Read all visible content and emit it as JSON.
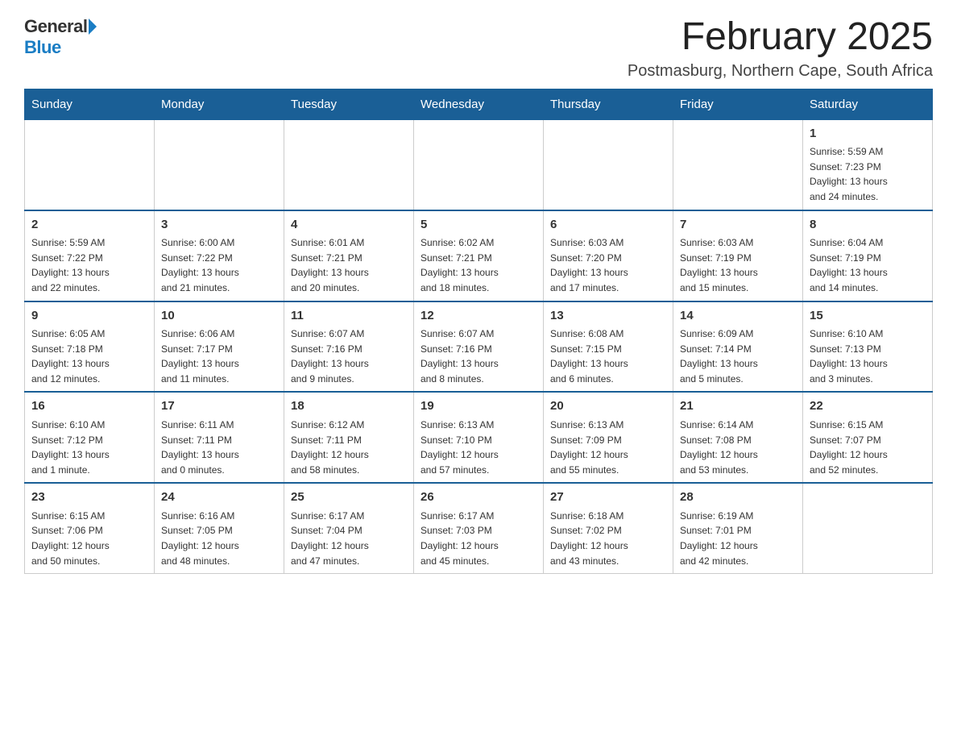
{
  "logo": {
    "general": "General",
    "blue": "Blue"
  },
  "header": {
    "month": "February 2025",
    "location": "Postmasburg, Northern Cape, South Africa"
  },
  "weekdays": [
    "Sunday",
    "Monday",
    "Tuesday",
    "Wednesday",
    "Thursday",
    "Friday",
    "Saturday"
  ],
  "weeks": [
    [
      {
        "day": "",
        "info": ""
      },
      {
        "day": "",
        "info": ""
      },
      {
        "day": "",
        "info": ""
      },
      {
        "day": "",
        "info": ""
      },
      {
        "day": "",
        "info": ""
      },
      {
        "day": "",
        "info": ""
      },
      {
        "day": "1",
        "info": "Sunrise: 5:59 AM\nSunset: 7:23 PM\nDaylight: 13 hours\nand 24 minutes."
      }
    ],
    [
      {
        "day": "2",
        "info": "Sunrise: 5:59 AM\nSunset: 7:22 PM\nDaylight: 13 hours\nand 22 minutes."
      },
      {
        "day": "3",
        "info": "Sunrise: 6:00 AM\nSunset: 7:22 PM\nDaylight: 13 hours\nand 21 minutes."
      },
      {
        "day": "4",
        "info": "Sunrise: 6:01 AM\nSunset: 7:21 PM\nDaylight: 13 hours\nand 20 minutes."
      },
      {
        "day": "5",
        "info": "Sunrise: 6:02 AM\nSunset: 7:21 PM\nDaylight: 13 hours\nand 18 minutes."
      },
      {
        "day": "6",
        "info": "Sunrise: 6:03 AM\nSunset: 7:20 PM\nDaylight: 13 hours\nand 17 minutes."
      },
      {
        "day": "7",
        "info": "Sunrise: 6:03 AM\nSunset: 7:19 PM\nDaylight: 13 hours\nand 15 minutes."
      },
      {
        "day": "8",
        "info": "Sunrise: 6:04 AM\nSunset: 7:19 PM\nDaylight: 13 hours\nand 14 minutes."
      }
    ],
    [
      {
        "day": "9",
        "info": "Sunrise: 6:05 AM\nSunset: 7:18 PM\nDaylight: 13 hours\nand 12 minutes."
      },
      {
        "day": "10",
        "info": "Sunrise: 6:06 AM\nSunset: 7:17 PM\nDaylight: 13 hours\nand 11 minutes."
      },
      {
        "day": "11",
        "info": "Sunrise: 6:07 AM\nSunset: 7:16 PM\nDaylight: 13 hours\nand 9 minutes."
      },
      {
        "day": "12",
        "info": "Sunrise: 6:07 AM\nSunset: 7:16 PM\nDaylight: 13 hours\nand 8 minutes."
      },
      {
        "day": "13",
        "info": "Sunrise: 6:08 AM\nSunset: 7:15 PM\nDaylight: 13 hours\nand 6 minutes."
      },
      {
        "day": "14",
        "info": "Sunrise: 6:09 AM\nSunset: 7:14 PM\nDaylight: 13 hours\nand 5 minutes."
      },
      {
        "day": "15",
        "info": "Sunrise: 6:10 AM\nSunset: 7:13 PM\nDaylight: 13 hours\nand 3 minutes."
      }
    ],
    [
      {
        "day": "16",
        "info": "Sunrise: 6:10 AM\nSunset: 7:12 PM\nDaylight: 13 hours\nand 1 minute."
      },
      {
        "day": "17",
        "info": "Sunrise: 6:11 AM\nSunset: 7:11 PM\nDaylight: 13 hours\nand 0 minutes."
      },
      {
        "day": "18",
        "info": "Sunrise: 6:12 AM\nSunset: 7:11 PM\nDaylight: 12 hours\nand 58 minutes."
      },
      {
        "day": "19",
        "info": "Sunrise: 6:13 AM\nSunset: 7:10 PM\nDaylight: 12 hours\nand 57 minutes."
      },
      {
        "day": "20",
        "info": "Sunrise: 6:13 AM\nSunset: 7:09 PM\nDaylight: 12 hours\nand 55 minutes."
      },
      {
        "day": "21",
        "info": "Sunrise: 6:14 AM\nSunset: 7:08 PM\nDaylight: 12 hours\nand 53 minutes."
      },
      {
        "day": "22",
        "info": "Sunrise: 6:15 AM\nSunset: 7:07 PM\nDaylight: 12 hours\nand 52 minutes."
      }
    ],
    [
      {
        "day": "23",
        "info": "Sunrise: 6:15 AM\nSunset: 7:06 PM\nDaylight: 12 hours\nand 50 minutes."
      },
      {
        "day": "24",
        "info": "Sunrise: 6:16 AM\nSunset: 7:05 PM\nDaylight: 12 hours\nand 48 minutes."
      },
      {
        "day": "25",
        "info": "Sunrise: 6:17 AM\nSunset: 7:04 PM\nDaylight: 12 hours\nand 47 minutes."
      },
      {
        "day": "26",
        "info": "Sunrise: 6:17 AM\nSunset: 7:03 PM\nDaylight: 12 hours\nand 45 minutes."
      },
      {
        "day": "27",
        "info": "Sunrise: 6:18 AM\nSunset: 7:02 PM\nDaylight: 12 hours\nand 43 minutes."
      },
      {
        "day": "28",
        "info": "Sunrise: 6:19 AM\nSunset: 7:01 PM\nDaylight: 12 hours\nand 42 minutes."
      },
      {
        "day": "",
        "info": ""
      }
    ]
  ]
}
